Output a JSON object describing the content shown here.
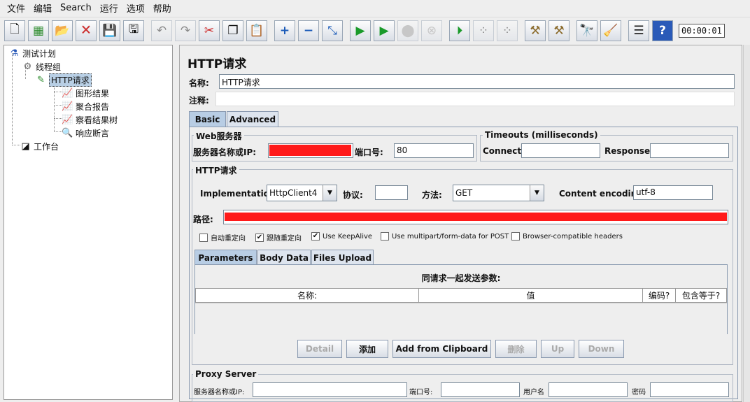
{
  "menu": [
    "文件",
    "编辑",
    "Search",
    "运行",
    "选项",
    "帮助"
  ],
  "toolbar": {
    "timer": "00:00:01",
    "icons": [
      "new-icon",
      "templates-icon",
      "open-icon",
      "close-icon",
      "save-icon",
      "save-as-icon",
      "undo-icon",
      "redo-icon",
      "cut-icon",
      "copy-icon",
      "paste-icon",
      "expand-icon",
      "collapse-icon",
      "toggle-icon",
      "start-icon",
      "start-no-pause-icon",
      "stop-icon",
      "shutdown-icon",
      "remote-start-icon",
      "remote-stop-icon",
      "remote-shutdown-icon",
      "clear-icon",
      "clear-all-icon",
      "search-icon",
      "reset-search-icon",
      "function-helper-icon",
      "help-icon"
    ]
  },
  "tree": {
    "test_plan": "测试计划",
    "thread_group": "线程组",
    "http_request": "HTTP请求",
    "graph_results": "图形结果",
    "aggregate_report": "聚合报告",
    "view_results_tree": "察看结果树",
    "response_assertion": "响应断言",
    "workbench": "工作台"
  },
  "panel": {
    "title": "HTTP请求",
    "name_label": "名称:",
    "name_value": "HTTP请求",
    "comment_label": "注释:",
    "comment_value": "",
    "tabs": [
      "Basic",
      "Advanced"
    ]
  },
  "web_server": {
    "title": "Web服务器",
    "server_label": "服务器名称或IP:",
    "port_label": "端口号:",
    "port_value": "80"
  },
  "timeouts": {
    "title": "Timeouts (milliseconds)",
    "connect_label": "Connect:",
    "response_label": "Response:"
  },
  "http_request": {
    "title": "HTTP请求",
    "impl_label": "Implementation:",
    "impl_value": "HttpClient4",
    "protocol_label": "协议:",
    "protocol_value": "",
    "method_label": "方法:",
    "method_value": "GET",
    "encoding_label": "Content encoding:",
    "encoding_value": "utf-8",
    "path_label": "路径:"
  },
  "options": [
    {
      "label": "自动重定向",
      "checked": false
    },
    {
      "label": "跟随重定向",
      "checked": true
    },
    {
      "label": "Use KeepAlive",
      "checked": true
    },
    {
      "label": "Use multipart/form-data for POST",
      "checked": false
    },
    {
      "label": "Browser-compatible headers",
      "checked": false
    }
  ],
  "param_tabs": [
    "Parameters",
    "Body Data",
    "Files Upload"
  ],
  "params": {
    "caption": "同请求一起发送参数:",
    "columns": [
      "名称:",
      "值",
      "编码?",
      "包含等于?"
    ]
  },
  "buttons": [
    "Detail",
    "添加",
    "Add from Clipboard",
    "删除",
    "Up",
    "Down"
  ],
  "proxy": {
    "title": "Proxy Server",
    "server_label": "服务器名称或IP:",
    "port_label": "端口号:",
    "user_label": "用户名",
    "password_label": "密码"
  }
}
